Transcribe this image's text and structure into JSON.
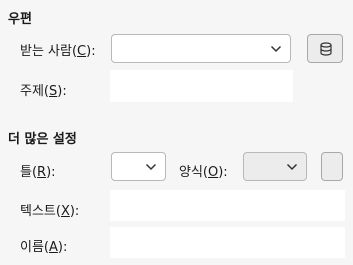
{
  "mail": {
    "heading": "우편",
    "recipient": {
      "label_pre": "받는 사람(",
      "key": "C",
      "label_post": "):",
      "value": ""
    },
    "subject": {
      "label_pre": "주제(",
      "key": "S",
      "label_post": "):",
      "value": ""
    },
    "addressbook_icon": "database-icon"
  },
  "more": {
    "heading": "더 많은 설정",
    "frame": {
      "label_pre": "틀(",
      "key": "R",
      "label_post": "):",
      "value": ""
    },
    "style": {
      "label_pre": "양식(",
      "key": "O",
      "label_post": "):",
      "value": ""
    },
    "text": {
      "label_pre": "텍스트(",
      "key": "X",
      "label_post": "):",
      "value": ""
    },
    "name": {
      "label_pre": "이름(",
      "key": "A",
      "label_post": "):",
      "value": ""
    }
  },
  "colors": {
    "background": "#f6f6f6",
    "field": "#ffffff",
    "border": "#b8b8b8"
  }
}
